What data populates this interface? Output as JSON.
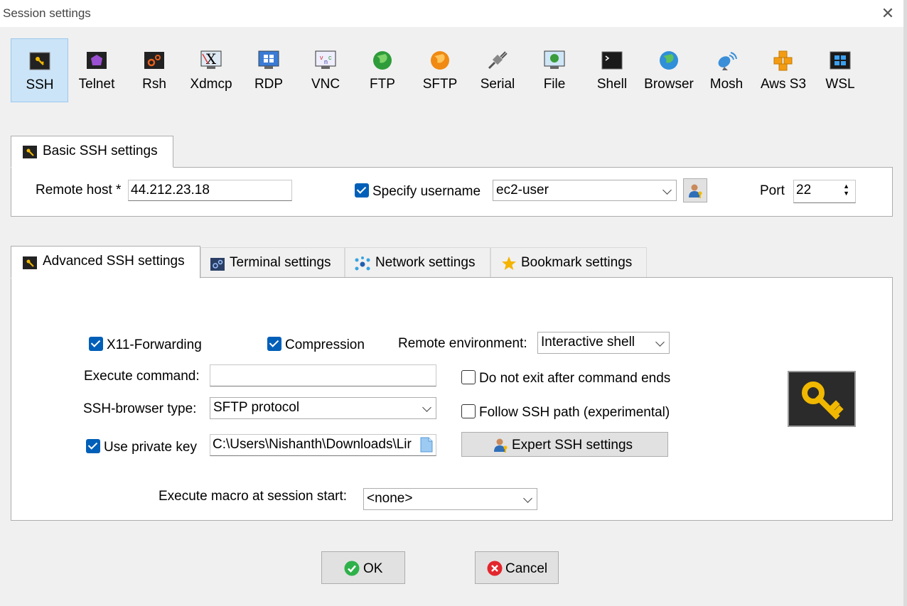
{
  "window": {
    "title": "Session settings"
  },
  "session_types": [
    {
      "label": "SSH",
      "icon": "ssh-key-icon",
      "selected": true
    },
    {
      "label": "Telnet",
      "icon": "telnet-icon"
    },
    {
      "label": "Rsh",
      "icon": "rsh-icon"
    },
    {
      "label": "Xdmcp",
      "icon": "xdmcp-icon"
    },
    {
      "label": "RDP",
      "icon": "rdp-icon"
    },
    {
      "label": "VNC",
      "icon": "vnc-icon"
    },
    {
      "label": "FTP",
      "icon": "ftp-globe-icon"
    },
    {
      "label": "SFTP",
      "icon": "sftp-globe-icon"
    },
    {
      "label": "Serial",
      "icon": "serial-plug-icon"
    },
    {
      "label": "File",
      "icon": "file-monitor-icon"
    },
    {
      "label": "Shell",
      "icon": "shell-terminal-icon"
    },
    {
      "label": "Browser",
      "icon": "browser-globe-icon"
    },
    {
      "label": "Mosh",
      "icon": "mosh-satellite-icon"
    },
    {
      "label": "Aws S3",
      "icon": "aws-s3-icon"
    },
    {
      "label": "WSL",
      "icon": "wsl-windows-icon"
    }
  ],
  "basic": {
    "tab_label": "Basic SSH settings",
    "remote_host_label": "Remote host *",
    "remote_host_value": "44.212.23.18",
    "specify_username_label": "Specify username",
    "specify_username_checked": true,
    "username_value": "ec2-user",
    "port_label": "Port",
    "port_value": "22"
  },
  "tabs": [
    {
      "label": "Advanced SSH settings",
      "icon": "ssh-key-icon",
      "active": true
    },
    {
      "label": "Terminal settings",
      "icon": "terminal-gears-icon"
    },
    {
      "label": "Network settings",
      "icon": "network-nodes-icon"
    },
    {
      "label": "Bookmark settings",
      "icon": "star-icon"
    }
  ],
  "advanced": {
    "x11_label": "X11-Forwarding",
    "x11_checked": true,
    "compression_label": "Compression",
    "compression_checked": true,
    "remote_env_label": "Remote environment:",
    "remote_env_value": "Interactive shell",
    "execute_command_label": "Execute command:",
    "execute_command_value": "",
    "do_not_exit_label": "Do not exit after command ends",
    "do_not_exit_checked": false,
    "ssh_browser_label": "SSH-browser type:",
    "ssh_browser_value": "SFTP protocol",
    "follow_path_label": "Follow SSH path (experimental)",
    "follow_path_checked": false,
    "use_private_key_label": "Use private key",
    "use_private_key_checked": true,
    "private_key_value": "C:\\Users\\Nishanth\\Downloads\\Lir",
    "expert_button_label": "Expert SSH settings",
    "macro_label": "Execute macro at session start:",
    "macro_value": "<none>"
  },
  "buttons": {
    "ok": "OK",
    "cancel": "Cancel"
  },
  "colors": {
    "accent": "#005fb8",
    "selected_bg": "#cce4f7",
    "ok_green": "#2fb14a",
    "cancel_red": "#e3262c"
  }
}
